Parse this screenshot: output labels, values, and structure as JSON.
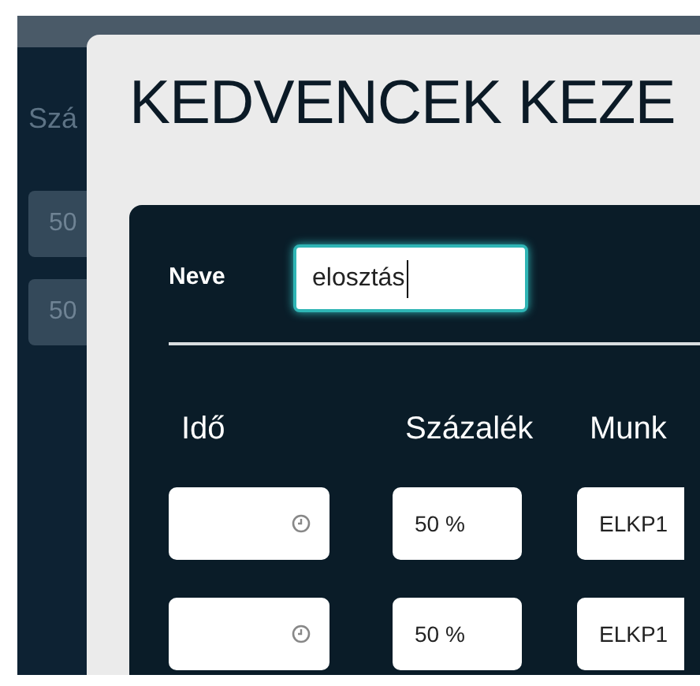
{
  "background": {
    "column_label": "Szá",
    "fields": [
      "50",
      "50"
    ]
  },
  "dialog": {
    "title": "KEDVENCEK KEZE",
    "name_label": "Neve",
    "name_value": "elosztás",
    "columns": [
      "Idő",
      "Százalék",
      "Munk"
    ],
    "rows": [
      {
        "time": "",
        "percent": "50 %",
        "work": "ELKP1"
      },
      {
        "time": "",
        "percent": "50 %",
        "work": "ELKP1"
      }
    ]
  }
}
